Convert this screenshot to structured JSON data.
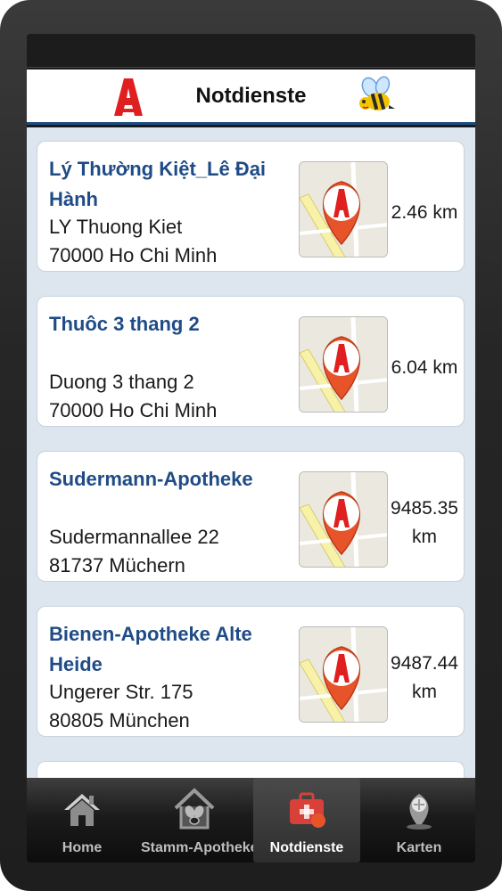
{
  "header": {
    "title": "Notdienste"
  },
  "pharmacies": [
    {
      "name": "Lý Thường Kiệt_Lê Đại Hành",
      "street": "LY Thuong Kiet",
      "city": "70000 Ho Chi Minh",
      "distance": "2.46 km"
    },
    {
      "name": "Thuôc 3 thang 2",
      "street": "Duong 3 thang 2",
      "city": "70000 Ho Chi Minh",
      "distance": "6.04 km"
    },
    {
      "name": "Sudermann-Apotheke",
      "street": "Sudermannallee 22",
      "city": "81737 Müchern",
      "distance_value": "9485.35",
      "distance_unit": "km"
    },
    {
      "name": "Bienen-Apotheke Alte Heide",
      "street": "Ungerer Str. 175",
      "city": "80805 München",
      "distance_value": "9487.44",
      "distance_unit": "km"
    }
  ],
  "tabs": [
    {
      "label": "Home",
      "icon": "home-icon"
    },
    {
      "label": "Stamm-Apotheke",
      "icon": "pharmacy-house-icon"
    },
    {
      "label": "Notdienste",
      "icon": "emergency-kit-icon",
      "active": true
    },
    {
      "label": "Karten",
      "icon": "map-pin-icon"
    }
  ],
  "colors": {
    "accent": "#1d4f86",
    "pharmacy_red": "#e02020",
    "pin_orange": "#e8542a"
  }
}
